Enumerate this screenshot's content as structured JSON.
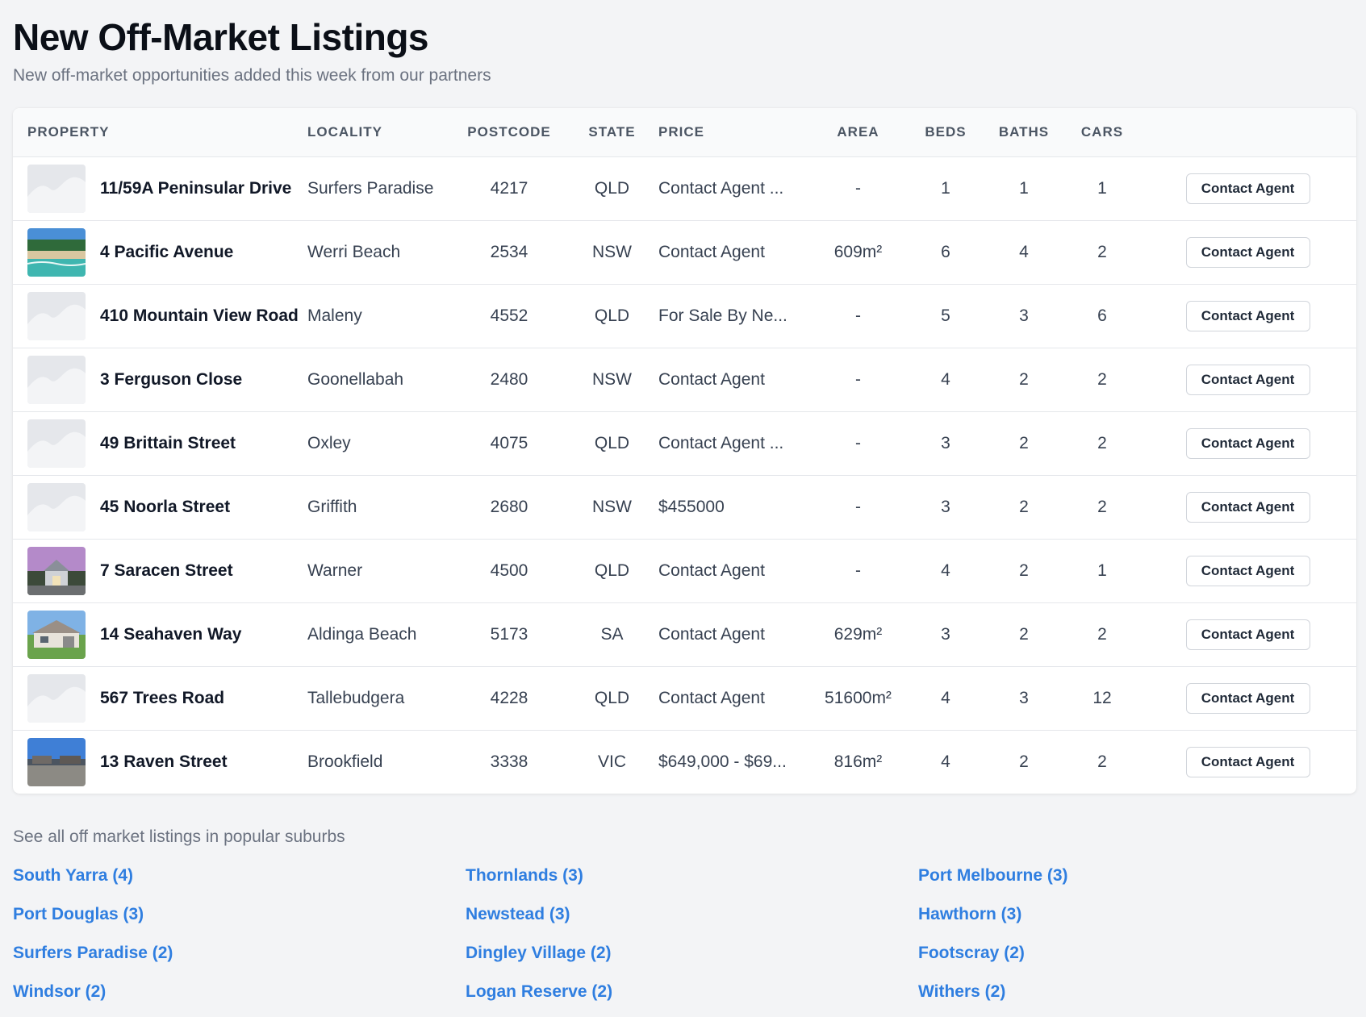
{
  "header": {
    "title": "New Off-Market Listings",
    "subtitle": "New off-market opportunities added this week from our partners"
  },
  "table": {
    "columns": [
      "PROPERTY",
      "LOCALITY",
      "POSTCODE",
      "STATE",
      "PRICE",
      "AREA",
      "BEDS",
      "BATHS",
      "CARS"
    ],
    "rows": [
      {
        "thumb": "placeholder",
        "property": "11/59A Peninsular Drive",
        "locality": "Surfers Paradise",
        "postcode": "4217",
        "state": "QLD",
        "price": "Contact Agent ...",
        "area": "-",
        "beds": "1",
        "baths": "1",
        "cars": "1",
        "action": "Contact Agent"
      },
      {
        "thumb": "beach",
        "property": "4 Pacific Avenue",
        "locality": "Werri Beach",
        "postcode": "2534",
        "state": "NSW",
        "price": "Contact Agent",
        "area": "609m²",
        "beds": "6",
        "baths": "4",
        "cars": "2",
        "action": "Contact Agent"
      },
      {
        "thumb": "placeholder",
        "property": "410 Mountain View Road",
        "locality": "Maleny",
        "postcode": "4552",
        "state": "QLD",
        "price": "For Sale By Ne...",
        "area": "-",
        "beds": "5",
        "baths": "3",
        "cars": "6",
        "action": "Contact Agent"
      },
      {
        "thumb": "placeholder",
        "property": "3 Ferguson Close",
        "locality": "Goonellabah",
        "postcode": "2480",
        "state": "NSW",
        "price": "Contact Agent",
        "area": "-",
        "beds": "4",
        "baths": "2",
        "cars": "2",
        "action": "Contact Agent"
      },
      {
        "thumb": "placeholder",
        "property": "49 Brittain Street",
        "locality": "Oxley",
        "postcode": "4075",
        "state": "QLD",
        "price": "Contact Agent ...",
        "area": "-",
        "beds": "3",
        "baths": "2",
        "cars": "2",
        "action": "Contact Agent"
      },
      {
        "thumb": "placeholder",
        "property": "45 Noorla Street",
        "locality": "Griffith",
        "postcode": "2680",
        "state": "NSW",
        "price": "$455000",
        "area": "-",
        "beds": "3",
        "baths": "2",
        "cars": "2",
        "action": "Contact Agent"
      },
      {
        "thumb": "dusk-house",
        "property": "7 Saracen Street",
        "locality": "Warner",
        "postcode": "4500",
        "state": "QLD",
        "price": "Contact Agent",
        "area": "-",
        "beds": "4",
        "baths": "2",
        "cars": "1",
        "action": "Contact Agent"
      },
      {
        "thumb": "house",
        "property": "14 Seahaven Way",
        "locality": "Aldinga Beach",
        "postcode": "5173",
        "state": "SA",
        "price": "Contact Agent",
        "area": "629m²",
        "beds": "3",
        "baths": "2",
        "cars": "2",
        "action": "Contact Agent"
      },
      {
        "thumb": "placeholder",
        "property": "567 Trees Road",
        "locality": "Tallebudgera",
        "postcode": "4228",
        "state": "QLD",
        "price": "Contact Agent",
        "area": "51600m²",
        "beds": "4",
        "baths": "3",
        "cars": "12",
        "action": "Contact Agent"
      },
      {
        "thumb": "street",
        "property": "13 Raven Street",
        "locality": "Brookfield",
        "postcode": "3338",
        "state": "VIC",
        "price": "$649,000 - $69...",
        "area": "816m²",
        "beds": "4",
        "baths": "2",
        "cars": "2",
        "action": "Contact Agent"
      }
    ]
  },
  "popular": {
    "title": "See all off market listings in popular suburbs",
    "links": [
      "South Yarra (4)",
      "Thornlands (3)",
      "Port Melbourne (3)",
      "Port Douglas (3)",
      "Newstead (3)",
      "Hawthorn (3)",
      "Surfers Paradise (2)",
      "Dingley Village (2)",
      "Footscray (2)",
      "Windsor (2)",
      "Logan Reserve (2)",
      "Withers (2)"
    ]
  },
  "colors": {
    "link": "#2f7ee0",
    "background": "#f3f4f6"
  }
}
